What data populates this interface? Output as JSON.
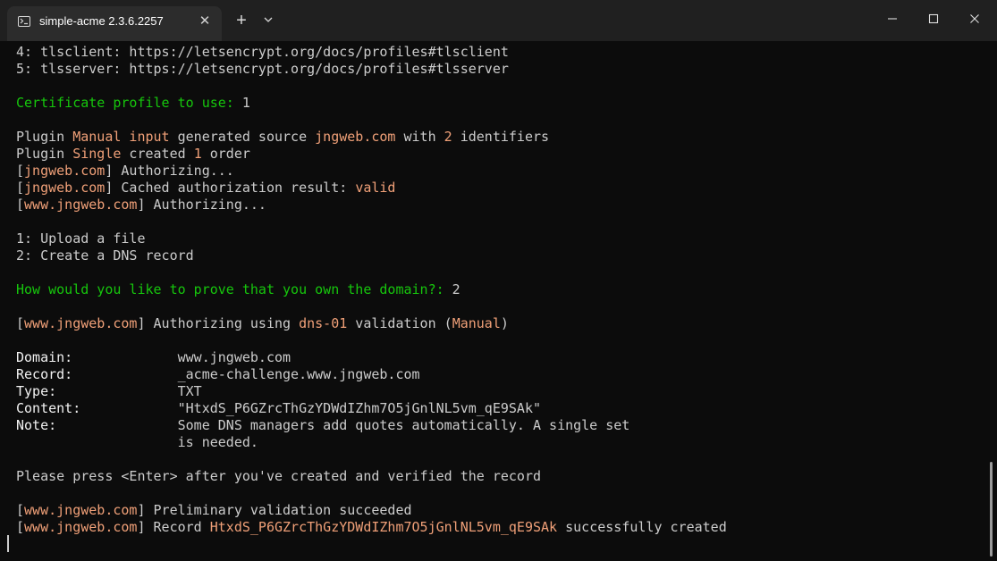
{
  "window": {
    "tab_title": "simple-acme 2.3.6.2257",
    "tab_close": "✕",
    "new_tab": "+",
    "icons": [
      "terminal-icon",
      "close-icon",
      "plus-icon",
      "chevron-down-icon",
      "minimize-icon",
      "maximize-icon",
      "close-window-icon"
    ]
  },
  "colors": {
    "background": "#0c0c0c",
    "titlebar": "#202020",
    "tab": "#2c2c2c",
    "text": "#cccccc",
    "prompt_green": "#16c60c",
    "highlight_orange": "#f0a078"
  },
  "terminal": {
    "lines": [
      [
        {
          "t": "4: tlsclient: https://letsencrypt.org/docs/profiles#tlsclient"
        }
      ],
      [
        {
          "t": "5: tlsserver: https://letsencrypt.org/docs/profiles#tlsserver"
        }
      ],
      [
        {
          "t": ""
        }
      ],
      [
        {
          "t": "Certificate profile to use: ",
          "c": "green"
        },
        {
          "t": "1"
        }
      ],
      [
        {
          "t": ""
        }
      ],
      [
        {
          "t": "Plugin "
        },
        {
          "t": "Manual input",
          "c": "orange"
        },
        {
          "t": " generated source "
        },
        {
          "t": "jngweb.com",
          "c": "orange"
        },
        {
          "t": " with "
        },
        {
          "t": "2",
          "c": "orange"
        },
        {
          "t": " identifiers"
        }
      ],
      [
        {
          "t": "Plugin "
        },
        {
          "t": "Single",
          "c": "orange"
        },
        {
          "t": " created "
        },
        {
          "t": "1",
          "c": "orange"
        },
        {
          "t": " order"
        }
      ],
      [
        {
          "t": "["
        },
        {
          "t": "jngweb.com",
          "c": "orange"
        },
        {
          "t": "] Authorizing..."
        }
      ],
      [
        {
          "t": "["
        },
        {
          "t": "jngweb.com",
          "c": "orange"
        },
        {
          "t": "] Cached authorization result: "
        },
        {
          "t": "valid",
          "c": "orange"
        }
      ],
      [
        {
          "t": "["
        },
        {
          "t": "www.jngweb.com",
          "c": "orange"
        },
        {
          "t": "] Authorizing..."
        }
      ],
      [
        {
          "t": ""
        }
      ],
      [
        {
          "t": "1: Upload a file"
        }
      ],
      [
        {
          "t": "2: Create a DNS record"
        }
      ],
      [
        {
          "t": ""
        }
      ],
      [
        {
          "t": "How would you like to prove that you own the domain?: ",
          "c": "green"
        },
        {
          "t": "2"
        }
      ],
      [
        {
          "t": ""
        }
      ],
      [
        {
          "t": "["
        },
        {
          "t": "www.jngweb.com",
          "c": "orange"
        },
        {
          "t": "] Authorizing using "
        },
        {
          "t": "dns-01",
          "c": "orange"
        },
        {
          "t": " validation ("
        },
        {
          "t": "Manual",
          "c": "orange"
        },
        {
          "t": ")"
        }
      ],
      [
        {
          "t": ""
        }
      ],
      [
        {
          "t": "Domain:",
          "c": "lblue"
        },
        {
          "t": "             www.jngweb.com"
        }
      ],
      [
        {
          "t": "Record:",
          "c": "lblue"
        },
        {
          "t": "             _acme-challenge.www.jngweb.com"
        }
      ],
      [
        {
          "t": "Type:",
          "c": "lblue"
        },
        {
          "t": "               TXT"
        }
      ],
      [
        {
          "t": "Content:",
          "c": "lblue"
        },
        {
          "t": "            \"HtxdS_P6GZrcThGzYDWdIZhm7O5jGnlNL5vm_qE9SAk\""
        }
      ],
      [
        {
          "t": "Note:",
          "c": "lblue"
        },
        {
          "t": "               Some DNS managers add quotes automatically. A single set"
        }
      ],
      [
        {
          "t": "                    is needed."
        }
      ],
      [
        {
          "t": ""
        }
      ],
      [
        {
          "t": "Please press <Enter> after you've created and verified the record"
        }
      ],
      [
        {
          "t": ""
        }
      ],
      [
        {
          "t": "["
        },
        {
          "t": "www.jngweb.com",
          "c": "orange"
        },
        {
          "t": "] Preliminary validation succeeded"
        }
      ],
      [
        {
          "t": "["
        },
        {
          "t": "www.jngweb.com",
          "c": "orange"
        },
        {
          "t": "] Record "
        },
        {
          "t": "HtxdS_P6GZrcThGzYDWdIZhm7O5jGnlNL5vm_qE9SAk",
          "c": "orange"
        },
        {
          "t": " successfully created"
        }
      ]
    ]
  }
}
